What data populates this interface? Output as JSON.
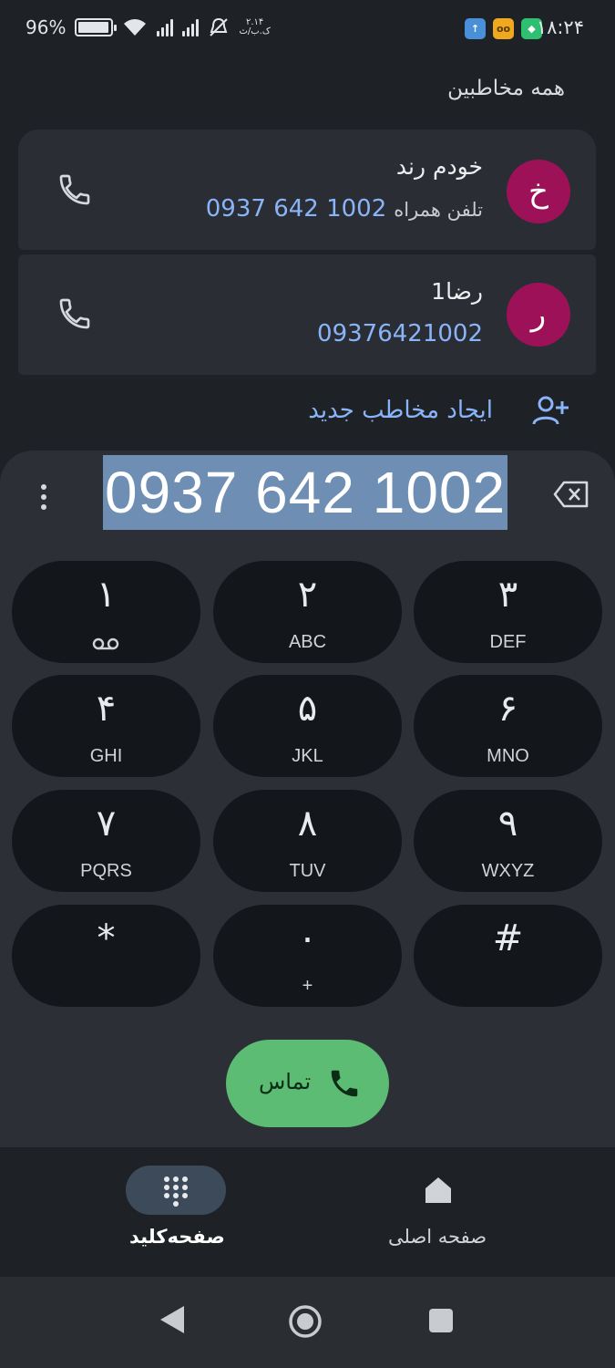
{
  "status_bar": {
    "time": "۱۸:۲۴",
    "battery_percent": "96%",
    "battery_level": 0.96,
    "network_speed": "۲.۱۴",
    "network_unit": "ک.ب/ث"
  },
  "contacts": {
    "header": "همه مخاطبین",
    "items": [
      {
        "initial": "خ",
        "name": "خودم رند",
        "type": "تلفن همراه",
        "number": "0937 642 1002"
      },
      {
        "initial": "ر",
        "name": "رضا1",
        "type": "",
        "number": "09376421002"
      }
    ],
    "create_label": "ایجاد مخاطب جدید"
  },
  "dialer": {
    "number": "0937 642 1002",
    "keys": [
      {
        "digit": "۱",
        "letters": ""
      },
      {
        "digit": "۲",
        "letters": "ABC"
      },
      {
        "digit": "۳",
        "letters": "DEF"
      },
      {
        "digit": "۴",
        "letters": "GHI"
      },
      {
        "digit": "۵",
        "letters": "JKL"
      },
      {
        "digit": "۶",
        "letters": "MNO"
      },
      {
        "digit": "۷",
        "letters": "PQRS"
      },
      {
        "digit": "۸",
        "letters": "TUV"
      },
      {
        "digit": "۹",
        "letters": "WXYZ"
      },
      {
        "digit": "*",
        "letters": ""
      },
      {
        "digit": "۰",
        "letters": "+"
      },
      {
        "digit": "#",
        "letters": ""
      }
    ],
    "call_label": "تماس"
  },
  "bottom_nav": {
    "keypad_label": "صفحه‌کلید",
    "home_label": "صفحه اصلی"
  },
  "colors": {
    "accent": "#8ab4f8",
    "call_green": "#5cbc73",
    "avatar": "#9d1159"
  },
  "icons": [
    "phone-icon",
    "add-person-icon",
    "backspace-icon",
    "more-vert-icon",
    "voicemail-icon",
    "dialpad-icon",
    "home-icon",
    "back-icon",
    "home-circle-icon",
    "recents-icon"
  ]
}
